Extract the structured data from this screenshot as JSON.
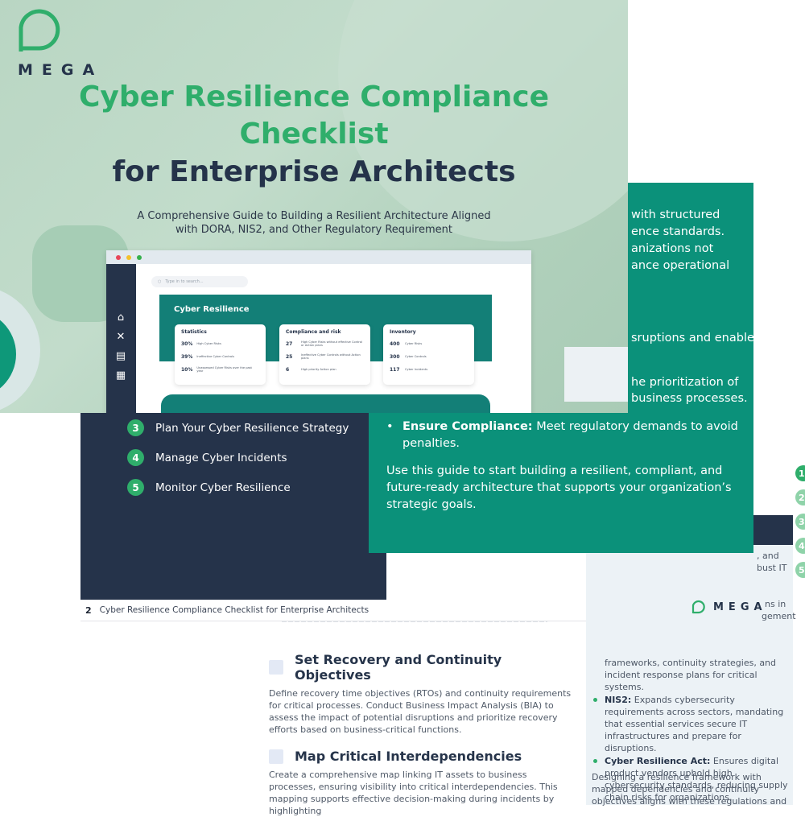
{
  "cover": {
    "logo_word": "MEGA",
    "title_line1": "Cyber Resilience Compliance",
    "title_line2": "Checklist",
    "title_line3": "for Enterprise Architects",
    "subtitle_line1": "A Comprehensive Guide to Building a Resilient Architecture Aligned",
    "subtitle_line2": "with DORA, NIS2, and Other Regulatory Requirement",
    "colors": {
      "green": "#2fae6b",
      "navy": "#25334a",
      "teal": "#137f77"
    }
  },
  "dashboard": {
    "search_placeholder": "Type in to search...",
    "banner_title": "Cyber Resilience",
    "sidebar_icons": [
      "home-icon",
      "tools-icon",
      "report-icon",
      "grid-icon"
    ],
    "cards": [
      {
        "title": "Statistics",
        "rows": [
          {
            "value": "30%",
            "label": "High Cyber Risks"
          },
          {
            "value": "39%",
            "label": "Ineffective Cyber Controls"
          },
          {
            "value": "10%",
            "label": "Unassessed Cyber Risks over the past year"
          }
        ]
      },
      {
        "title": "Compliance and risk",
        "rows": [
          {
            "value": "27",
            "label": "High Cyber Risks without effective Control or Action plans"
          },
          {
            "value": "25",
            "label": "Ineffective Cyber Controls without Action plans"
          },
          {
            "value": "6",
            "label": "High priority Action plan"
          }
        ]
      },
      {
        "title": "Inventory",
        "rows": [
          {
            "value": "400",
            "label": "Cyber Risks"
          },
          {
            "value": "300",
            "label": "Cyber Controls"
          },
          {
            "value": "117",
            "label": "Cyber Incidents"
          }
        ]
      }
    ]
  },
  "intro_page": {
    "fragments": [
      "with structured",
      "ence standards.",
      "anizations not",
      "ance operational",
      "sruptions and enable",
      "he prioritization of",
      "business processes."
    ],
    "bullet_bold": "Ensure Compliance:",
    "bullet_text": " Meet regulatory demands to avoid penalties.",
    "paragraph": "Use this guide to start building a resilient, compliant, and future-ready architecture that supports your organization’s strategic goals.",
    "logo_word": "MEGA"
  },
  "toc_page": {
    "items": [
      {
        "num": "3",
        "label": "Plan Your Cyber Resilience Strategy"
      },
      {
        "num": "4",
        "label": "Manage Cyber Incidents"
      },
      {
        "num": "5",
        "label": "Monitor Cyber Resilience"
      }
    ],
    "footer_page_number": "2",
    "footer_title": "Cyber Resilience Compliance Checklist for Enterprise Architects"
  },
  "checklist_page": {
    "sections": [
      {
        "title": "Set Recovery and Continuity Objectives",
        "body": "Define recovery time objectives (RTOs) and continuity requirements for critical processes. Conduct Business Impact Analysis (BIA) to assess the impact of potential disruptions and prioritize recovery efforts based on business-critical functions."
      },
      {
        "title": "Map Critical Interdependencies",
        "body": "Create a comprehensive map linking IT assets to business processes, ensuring visibility into critical interdependencies. This mapping supports effective decision-making during incidents by highlighting"
      }
    ],
    "side_fragments": [
      ", and",
      "bust IT",
      "ns in",
      "gement"
    ],
    "side_bullets": [
      {
        "bold": "",
        "text": "frameworks, continuity strategies, and incident response plans for critical systems."
      },
      {
        "bold": "NIS2:",
        "text": " Expands cybersecurity requirements across sectors, mandating that essential services secure IT infrastructures and prepare for disruptions."
      },
      {
        "bold": "Cyber Resilience Act:",
        "text": " Ensures digital product vendors uphold high cybersecurity standards, reducing supply chain risks for organizations."
      }
    ],
    "side_closing": "Designing a resilience framework with mapped dependencies and continuity objectives aligns with these regulations and",
    "number_stack": [
      "1",
      "2",
      "3",
      "4",
      "5"
    ]
  }
}
